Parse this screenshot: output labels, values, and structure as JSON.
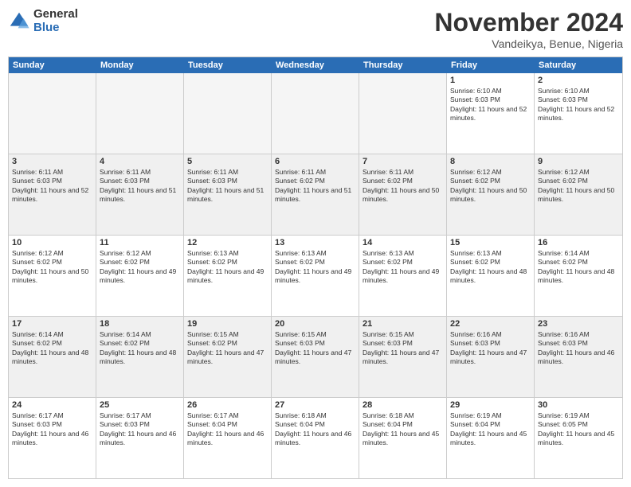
{
  "header": {
    "logo_general": "General",
    "logo_blue": "Blue",
    "month_title": "November 2024",
    "location": "Vandeikya, Benue, Nigeria"
  },
  "weekdays": [
    "Sunday",
    "Monday",
    "Tuesday",
    "Wednesday",
    "Thursday",
    "Friday",
    "Saturday"
  ],
  "rows": [
    [
      {
        "day": "",
        "empty": true
      },
      {
        "day": "",
        "empty": true
      },
      {
        "day": "",
        "empty": true
      },
      {
        "day": "",
        "empty": true
      },
      {
        "day": "",
        "empty": true
      },
      {
        "day": "1",
        "sunrise": "6:10 AM",
        "sunset": "6:03 PM",
        "daylight": "11 hours and 52 minutes."
      },
      {
        "day": "2",
        "sunrise": "6:10 AM",
        "sunset": "6:03 PM",
        "daylight": "11 hours and 52 minutes."
      }
    ],
    [
      {
        "day": "3",
        "sunrise": "6:11 AM",
        "sunset": "6:03 PM",
        "daylight": "11 hours and 52 minutes."
      },
      {
        "day": "4",
        "sunrise": "6:11 AM",
        "sunset": "6:03 PM",
        "daylight": "11 hours and 51 minutes."
      },
      {
        "day": "5",
        "sunrise": "6:11 AM",
        "sunset": "6:03 PM",
        "daylight": "11 hours and 51 minutes."
      },
      {
        "day": "6",
        "sunrise": "6:11 AM",
        "sunset": "6:02 PM",
        "daylight": "11 hours and 51 minutes."
      },
      {
        "day": "7",
        "sunrise": "6:11 AM",
        "sunset": "6:02 PM",
        "daylight": "11 hours and 50 minutes."
      },
      {
        "day": "8",
        "sunrise": "6:12 AM",
        "sunset": "6:02 PM",
        "daylight": "11 hours and 50 minutes."
      },
      {
        "day": "9",
        "sunrise": "6:12 AM",
        "sunset": "6:02 PM",
        "daylight": "11 hours and 50 minutes."
      }
    ],
    [
      {
        "day": "10",
        "sunrise": "6:12 AM",
        "sunset": "6:02 PM",
        "daylight": "11 hours and 50 minutes."
      },
      {
        "day": "11",
        "sunrise": "6:12 AM",
        "sunset": "6:02 PM",
        "daylight": "11 hours and 49 minutes."
      },
      {
        "day": "12",
        "sunrise": "6:13 AM",
        "sunset": "6:02 PM",
        "daylight": "11 hours and 49 minutes."
      },
      {
        "day": "13",
        "sunrise": "6:13 AM",
        "sunset": "6:02 PM",
        "daylight": "11 hours and 49 minutes."
      },
      {
        "day": "14",
        "sunrise": "6:13 AM",
        "sunset": "6:02 PM",
        "daylight": "11 hours and 49 minutes."
      },
      {
        "day": "15",
        "sunrise": "6:13 AM",
        "sunset": "6:02 PM",
        "daylight": "11 hours and 48 minutes."
      },
      {
        "day": "16",
        "sunrise": "6:14 AM",
        "sunset": "6:02 PM",
        "daylight": "11 hours and 48 minutes."
      }
    ],
    [
      {
        "day": "17",
        "sunrise": "6:14 AM",
        "sunset": "6:02 PM",
        "daylight": "11 hours and 48 minutes."
      },
      {
        "day": "18",
        "sunrise": "6:14 AM",
        "sunset": "6:02 PM",
        "daylight": "11 hours and 48 minutes."
      },
      {
        "day": "19",
        "sunrise": "6:15 AM",
        "sunset": "6:02 PM",
        "daylight": "11 hours and 47 minutes."
      },
      {
        "day": "20",
        "sunrise": "6:15 AM",
        "sunset": "6:03 PM",
        "daylight": "11 hours and 47 minutes."
      },
      {
        "day": "21",
        "sunrise": "6:15 AM",
        "sunset": "6:03 PM",
        "daylight": "11 hours and 47 minutes."
      },
      {
        "day": "22",
        "sunrise": "6:16 AM",
        "sunset": "6:03 PM",
        "daylight": "11 hours and 47 minutes."
      },
      {
        "day": "23",
        "sunrise": "6:16 AM",
        "sunset": "6:03 PM",
        "daylight": "11 hours and 46 minutes."
      }
    ],
    [
      {
        "day": "24",
        "sunrise": "6:17 AM",
        "sunset": "6:03 PM",
        "daylight": "11 hours and 46 minutes."
      },
      {
        "day": "25",
        "sunrise": "6:17 AM",
        "sunset": "6:03 PM",
        "daylight": "11 hours and 46 minutes."
      },
      {
        "day": "26",
        "sunrise": "6:17 AM",
        "sunset": "6:04 PM",
        "daylight": "11 hours and 46 minutes."
      },
      {
        "day": "27",
        "sunrise": "6:18 AM",
        "sunset": "6:04 PM",
        "daylight": "11 hours and 46 minutes."
      },
      {
        "day": "28",
        "sunrise": "6:18 AM",
        "sunset": "6:04 PM",
        "daylight": "11 hours and 45 minutes."
      },
      {
        "day": "29",
        "sunrise": "6:19 AM",
        "sunset": "6:04 PM",
        "daylight": "11 hours and 45 minutes."
      },
      {
        "day": "30",
        "sunrise": "6:19 AM",
        "sunset": "6:05 PM",
        "daylight": "11 hours and 45 minutes."
      }
    ]
  ]
}
